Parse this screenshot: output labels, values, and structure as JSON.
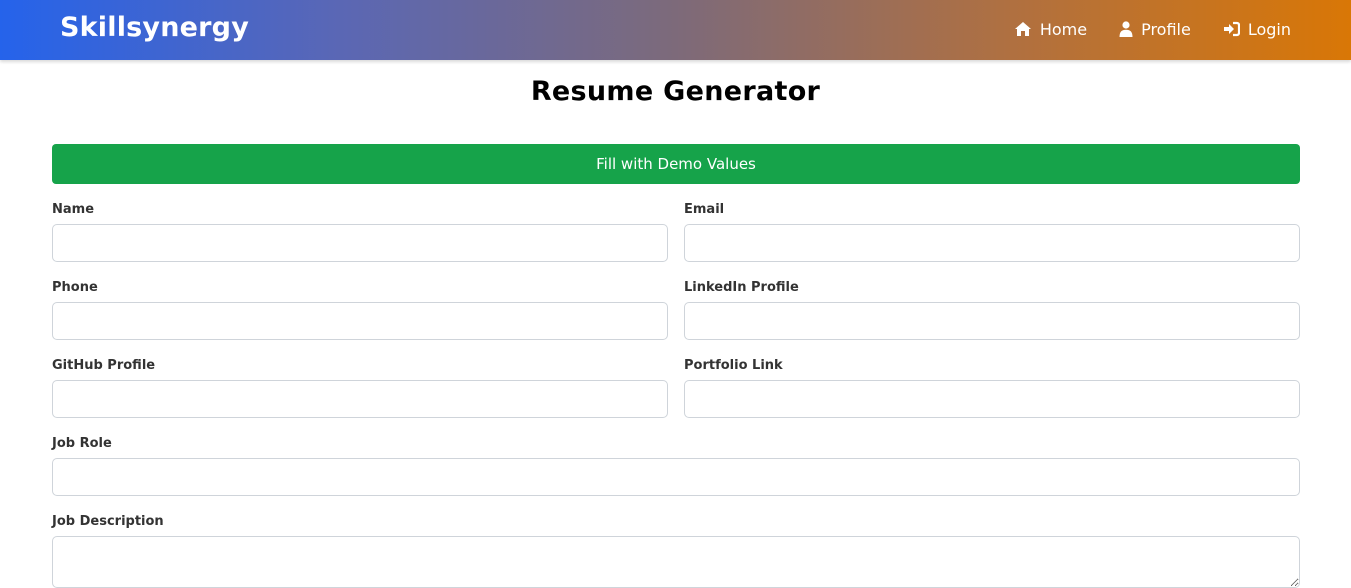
{
  "navbar": {
    "brand": "Skillsynergy",
    "links": [
      {
        "label": "Home",
        "icon": "home-icon"
      },
      {
        "label": "Profile",
        "icon": "user-icon"
      },
      {
        "label": "Login",
        "icon": "sign-in-icon"
      }
    ]
  },
  "page": {
    "title": "Resume Generator",
    "demo_button": "Fill with Demo Values"
  },
  "form": {
    "name": {
      "label": "Name",
      "value": "",
      "placeholder": ""
    },
    "email": {
      "label": "Email",
      "value": "",
      "placeholder": ""
    },
    "phone": {
      "label": "Phone",
      "value": "",
      "placeholder": ""
    },
    "linkedin": {
      "label": "LinkedIn Profile",
      "value": "",
      "placeholder": ""
    },
    "github": {
      "label": "GitHub Profile",
      "value": "",
      "placeholder": ""
    },
    "portfolio": {
      "label": "Portfolio Link",
      "value": "",
      "placeholder": ""
    },
    "job_role": {
      "label": "Job Role",
      "value": "",
      "placeholder": ""
    },
    "job_description": {
      "label": "Job Description",
      "value": "",
      "placeholder": ""
    }
  },
  "colors": {
    "gradient_start": "#2563eb",
    "gradient_end": "#d97706",
    "demo_button": "#16a34a"
  }
}
